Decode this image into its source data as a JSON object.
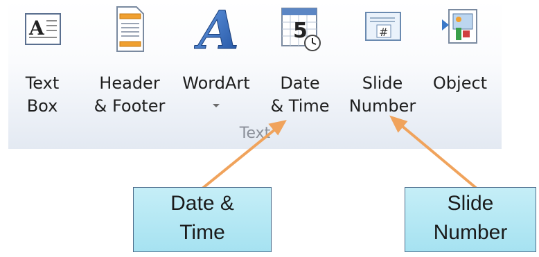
{
  "ribbon": {
    "buttons": [
      {
        "id": "text-box",
        "line1": "Text",
        "line2": "Box"
      },
      {
        "id": "header-footer",
        "line1": "Header",
        "line2": "& Footer"
      },
      {
        "id": "wordart",
        "line1": "WordArt",
        "line2": ""
      },
      {
        "id": "date-time",
        "line1": "Date",
        "line2": "& Time"
      },
      {
        "id": "slide-number",
        "line1": "Slide",
        "line2": "Number"
      },
      {
        "id": "object",
        "line1": "Object",
        "line2": ""
      }
    ],
    "group_label": "Text",
    "icons": {
      "text_box": "text-box-icon",
      "header_footer": "header-footer-icon",
      "wordart": "wordart-icon",
      "date_time": "calendar-clock-icon",
      "slide_number": "slide-number-icon",
      "object": "object-icon"
    },
    "wordart_glyph": "A",
    "text_box_glyph": "A",
    "calendar_digit": "5",
    "slide_number_glyph": "#"
  },
  "callouts": {
    "date_time": {
      "line1": "Date &",
      "line2": "Time"
    },
    "slide_number": {
      "line1": "Slide",
      "line2": "Number"
    }
  },
  "colors": {
    "arrow": "#f0a35c",
    "callout_fill": "#b8e8f4",
    "callout_border": "#4a6b8a",
    "wordart_blue": "#2d5fb0",
    "header_accent": "#f0a030"
  }
}
